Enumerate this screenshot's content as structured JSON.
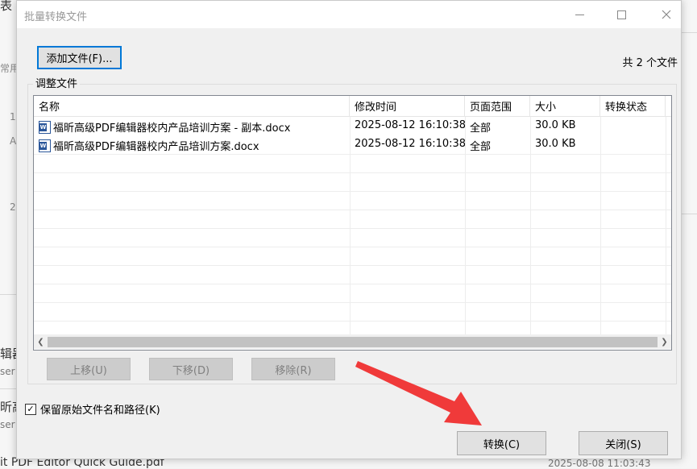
{
  "dialog": {
    "title": "批量转换文件",
    "window_controls": {
      "minimize": "minimize-icon",
      "maximize": "maximize-icon",
      "close": "close-icon"
    },
    "add_file_label": "添加文件(F)...",
    "file_count": "共 2 个文件",
    "group_label": "调整文件",
    "columns": [
      "名称",
      "修改时间",
      "页面范围",
      "大小",
      "转换状态"
    ],
    "files": [
      {
        "name": "福昕高级PDF编辑器校内产品培训方案 - 副本.docx",
        "modified": "2025-08-12 16:10:38",
        "range": "全部",
        "size": "30.0 KB",
        "status": "",
        "icon": "word-doc-icon"
      },
      {
        "name": "福昕高级PDF编辑器校内产品培训方案.docx",
        "modified": "2025-08-12 16:10:38",
        "range": "全部",
        "size": "30.0 KB",
        "status": "",
        "icon": "word-doc-icon"
      }
    ],
    "move_up_label": "上移(U)",
    "move_down_label": "下移(D)",
    "remove_label": "移除(R)",
    "keep_name_label": "保留原始文件名和路径(K)",
    "keep_name_checked": true,
    "convert_label": "转换(C)",
    "close_label": "关闭(S)"
  },
  "background": {
    "fragments": [
      "表",
      "常用",
      "1",
      "A",
      "2",
      "辑器",
      "ser",
      "昕高",
      "ser",
      "it PDF Editor Quick Guide.pdf",
      "2025-08-08 11:03:43"
    ]
  },
  "annotation": {
    "arrow_color": "#f03a3a"
  }
}
